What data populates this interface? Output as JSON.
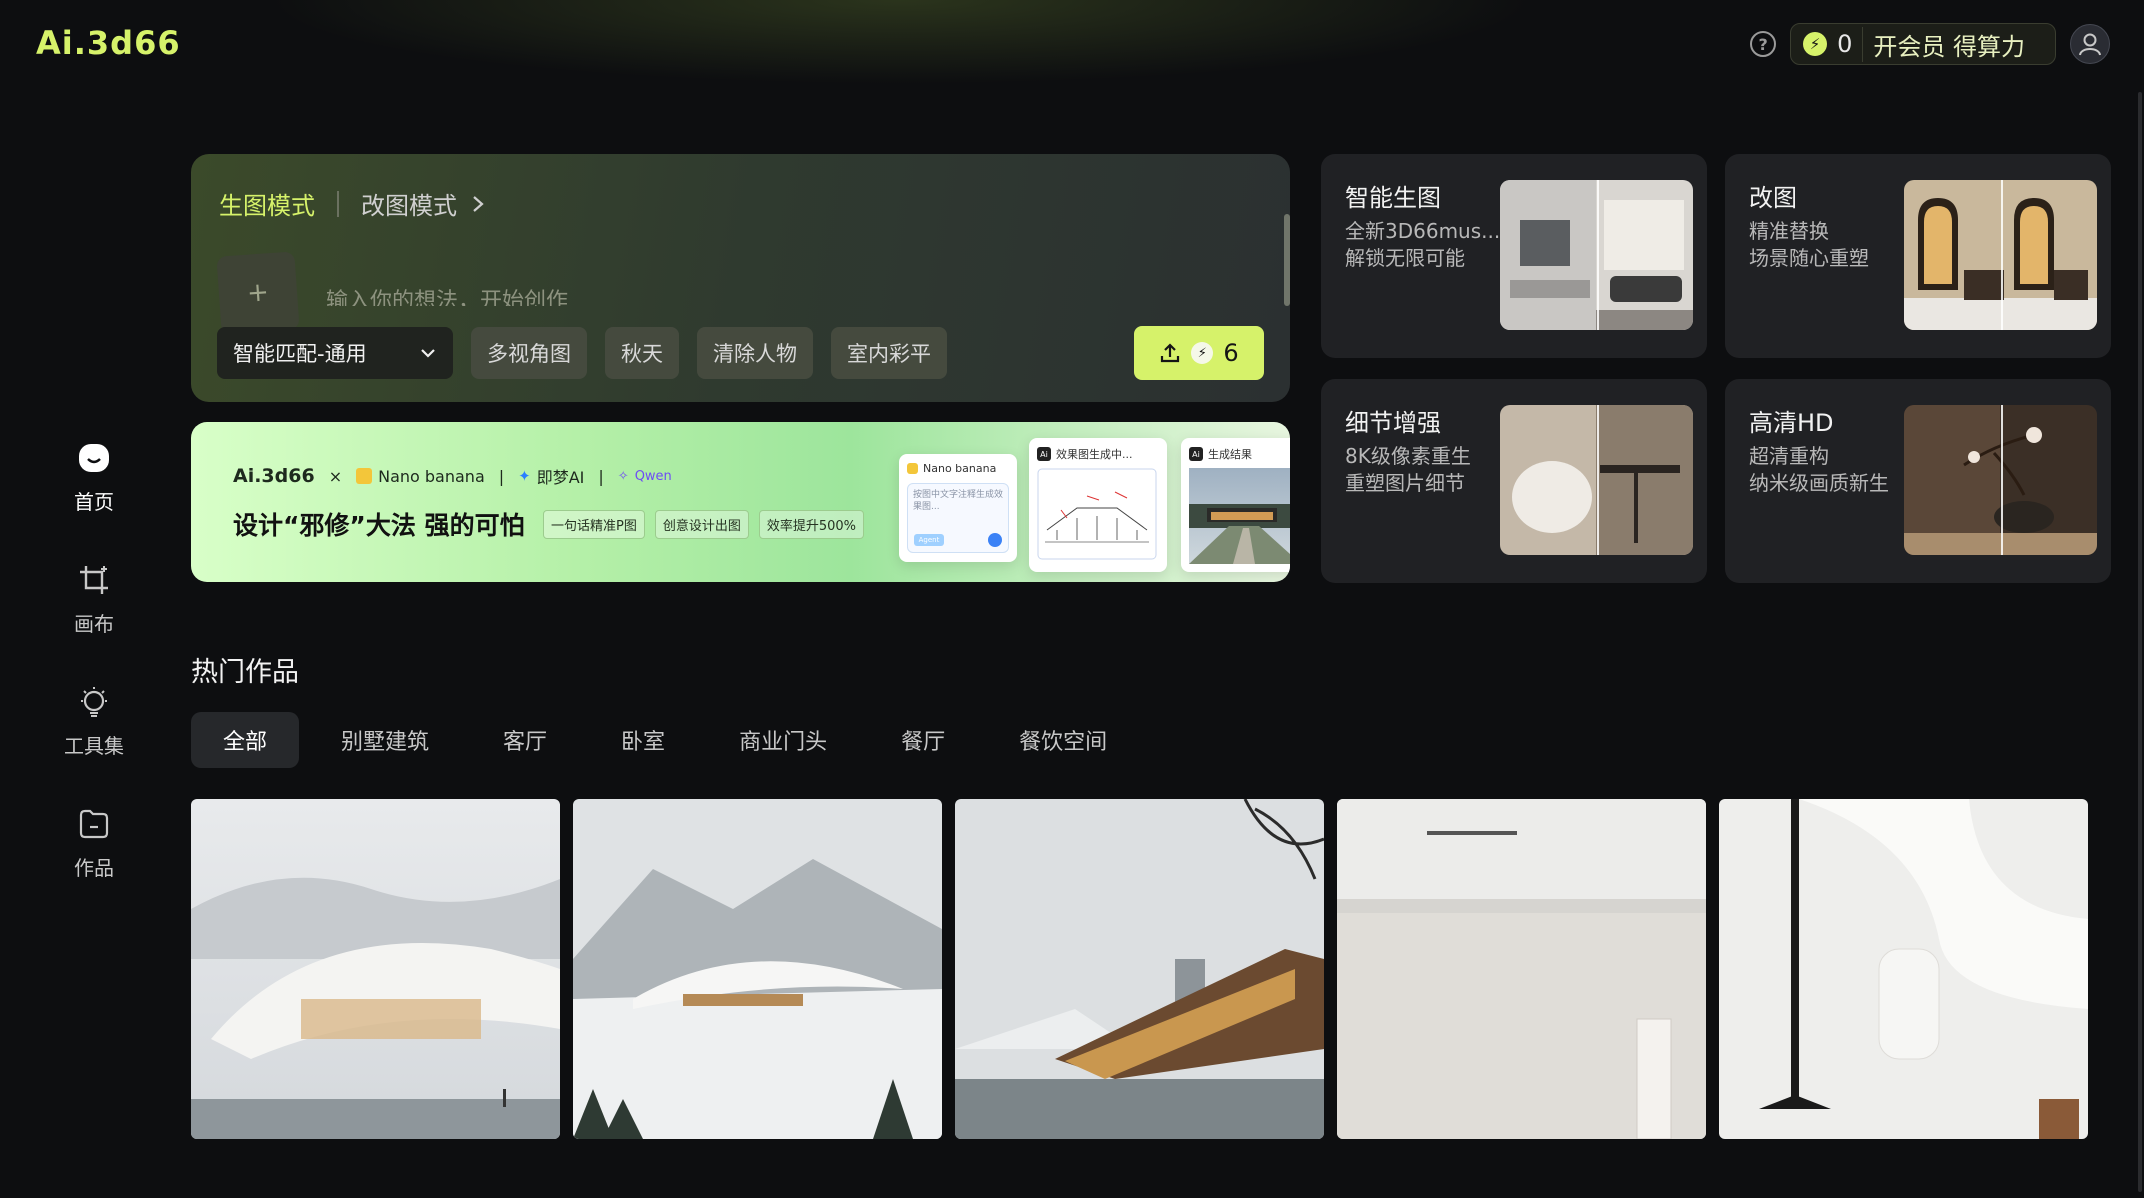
{
  "header": {
    "logo": "Ai.3d66",
    "help": "?",
    "points": "0",
    "vip_label": "开会员 得算力"
  },
  "sidebar": {
    "items": [
      {
        "label": "首页",
        "icon": "home-icon",
        "active": true
      },
      {
        "label": "画布",
        "icon": "crop-canvas-icon",
        "active": false
      },
      {
        "label": "工具集",
        "icon": "lightbulb-icon",
        "active": false
      },
      {
        "label": "作品",
        "icon": "folder-icon",
        "active": false
      }
    ]
  },
  "prompt": {
    "mode_active": "生图模式",
    "mode_other": "改图模式",
    "placeholder": "输入你的想法，开始创作",
    "select_value": "智能匹配-通用",
    "chips": [
      "多视角图",
      "秋天",
      "清除人物",
      "室内彩平"
    ],
    "cost": "6"
  },
  "banner": {
    "logo": "Ai.3d66",
    "x": "×",
    "partner1": "Nano banana",
    "partner2": "即梦AI",
    "partner3": "Qwen",
    "sep": "|",
    "title": "设计“邪修”大法 强的可怕",
    "tags": [
      "一句话精准P图",
      "创意设计出图",
      "效率提升500%"
    ],
    "mini1_title": "Nano banana",
    "mini1_text": "按图中文字注释生成效果图...",
    "mini1_agent": "Agent",
    "mini2_title": "效果图生成中...",
    "mini3_title": "生成结果"
  },
  "features": [
    {
      "title": "智能生图",
      "line1": "全新3D66mus...",
      "line2": "解锁无限可能"
    },
    {
      "title": "改图",
      "line1": "精准替换",
      "line2": "场景随心重塑"
    },
    {
      "title": "细节增强",
      "line1": "8K级像素重生",
      "line2": "重塑图片细节"
    },
    {
      "title": "高清HD",
      "line1": "超清重构",
      "line2": "纳米级画质新生"
    }
  ],
  "hot": {
    "title": "热门作品",
    "filters": [
      "全部",
      "别墅建筑",
      "客厅",
      "卧室",
      "商业门头",
      "餐厅",
      "餐饮空间"
    ]
  },
  "colors": {
    "accent": "#d6f26a",
    "background": "#0d0e10",
    "card": "#202124"
  }
}
